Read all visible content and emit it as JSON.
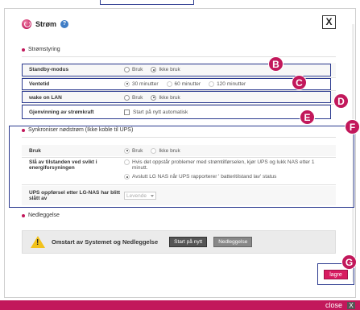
{
  "dialog": {
    "title": "Strøm",
    "help": "?",
    "close": "X"
  },
  "section_power": {
    "heading": "Strømstyring",
    "rows": [
      {
        "label": "Standby-modus",
        "options": [
          "Bruk",
          "Ikke bruk"
        ],
        "selected": 1
      },
      {
        "label": "Ventetid",
        "options": [
          "30 minutter",
          "60 minutter",
          "120 minutter"
        ],
        "selected": 0
      },
      {
        "label": "wake on LAN",
        "options": [
          "Bruk",
          "Ikke bruk"
        ],
        "selected": 1
      },
      {
        "label": "Gjenvinning av strømkraft",
        "checkbox_label": "Start på nytt automatisk",
        "checked": false
      }
    ]
  },
  "section_ups": {
    "heading": "Synkroniser nødstrøm (Ikke koble til UPS)",
    "row1": {
      "label": "Bruk",
      "options": [
        "Bruk",
        "Ikke bruk"
      ]
    },
    "row2": {
      "label": "Slå av tilstanden ved svikt i energiforsyningen",
      "option1": "Hvis det oppstår problemer med strømtilførselen, kjør UPS og lukk NAS etter 1 minutt.",
      "option2": "Avslutt LG NAS når UPS rapporterer ' batteritilstand lav' status"
    },
    "row3": {
      "label": "UPS oppførsel etter LG-NAS har blitt slått av",
      "select_value": "Levende"
    }
  },
  "section_shutdown": {
    "heading": "Nedleggelse",
    "text": "Omstart av Systemet og Nedleggelse",
    "restart_button": "Start på nytt",
    "shutdown_button": "Nedleggelse"
  },
  "save_button": "lagre",
  "bottom_bar": {
    "close_label": "close",
    "close_icon": "X"
  },
  "annotations": [
    "B",
    "C",
    "D",
    "E",
    "F",
    "G"
  ],
  "colors": {
    "accent": "#c2185b",
    "highlight_border": "#2b3a8f"
  }
}
